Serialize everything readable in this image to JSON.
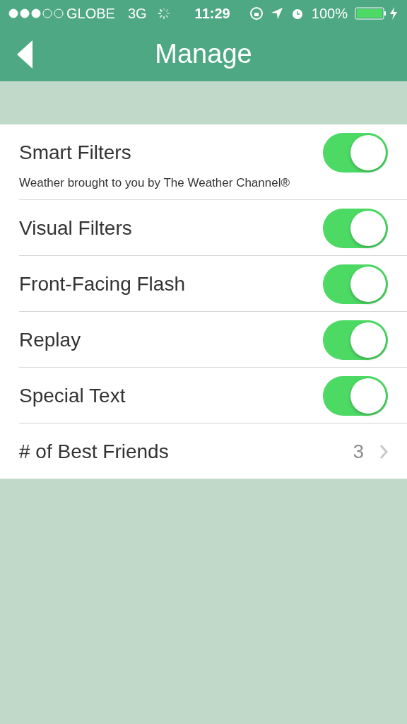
{
  "status_bar": {
    "carrier": "GLOBE",
    "network": "3G",
    "time": "11:29",
    "battery": "100%"
  },
  "nav": {
    "title": "Manage"
  },
  "rows": [
    {
      "kind": "toggle",
      "label": "Smart Filters",
      "note": "Weather brought to you by The Weather Channel®",
      "on": true
    },
    {
      "kind": "toggle",
      "label": "Visual Filters",
      "on": true
    },
    {
      "kind": "toggle",
      "label": "Front-Facing Flash",
      "on": true
    },
    {
      "kind": "toggle",
      "label": "Replay",
      "on": true
    },
    {
      "kind": "toggle",
      "label": "Special Text",
      "on": true
    },
    {
      "kind": "disclosure",
      "label": "# of Best Friends",
      "value": "3"
    }
  ]
}
